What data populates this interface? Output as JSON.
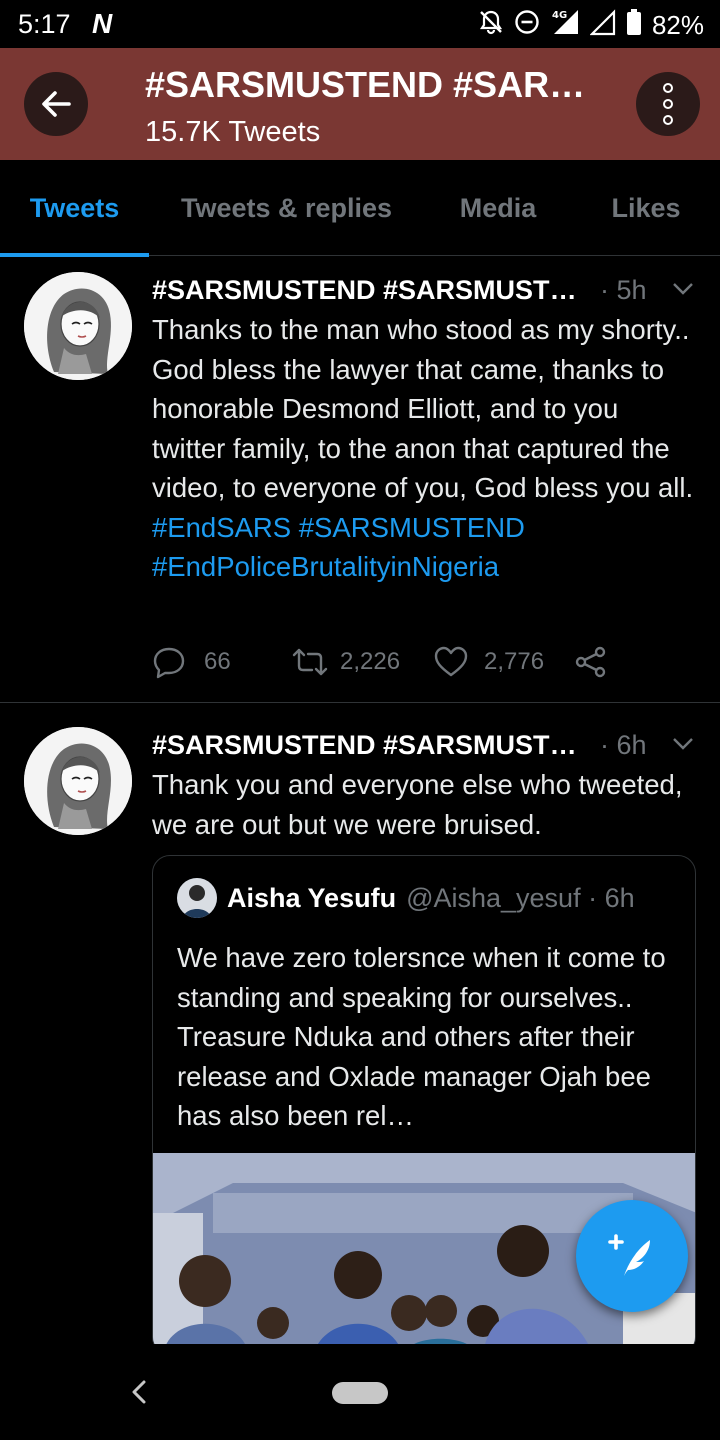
{
  "status_bar": {
    "time": "5:17",
    "notification_icon": "netflix-n-icon",
    "battery": "82%",
    "network": "4G"
  },
  "header": {
    "title": "#SARSMUSTEND #SARSMUSTEND",
    "subtitle": "15.7K Tweets",
    "background": "#7a3733"
  },
  "tabs": [
    {
      "label": "Tweets",
      "active": true
    },
    {
      "label": "Tweets & replies",
      "active": false
    },
    {
      "label": "Media",
      "active": false
    },
    {
      "label": "Likes",
      "active": false
    }
  ],
  "tweets": [
    {
      "name": "#SARSMUSTEND #SARSMUSTEND",
      "time": "· 5h",
      "text_plain": "Thanks to the man who stood as my shorty.. God bless the lawyer that came, thanks to honorable Desmond Elliott, and to you twitter family, to the anon that captured the video, to everyone of you, God bless you all.",
      "hashtags": [
        "#EndSARS",
        "#SARSMUSTEND",
        "#EndPoliceBrutalityinNigeria"
      ],
      "replies": "66",
      "retweets": "2,226",
      "likes": "2,776"
    },
    {
      "name": "#SARSMUSTEND #SARSMUSTEND",
      "time": "· 6h",
      "text_plain": "Thank you and everyone else who tweeted, we are out but we were bruised.",
      "quote": {
        "name": "Aisha Yesufu",
        "handle": "@Aisha_yesuf · 6h",
        "text": "We have zero tolersnce when it come to standing and speaking for ourselves.. Treasure Nduka and others after their release and Oxlade manager Ojah bee has also been rel…"
      }
    }
  ],
  "colors": {
    "accent": "#1d9bf0",
    "muted": "#71767b",
    "divider": "#2f3336"
  }
}
